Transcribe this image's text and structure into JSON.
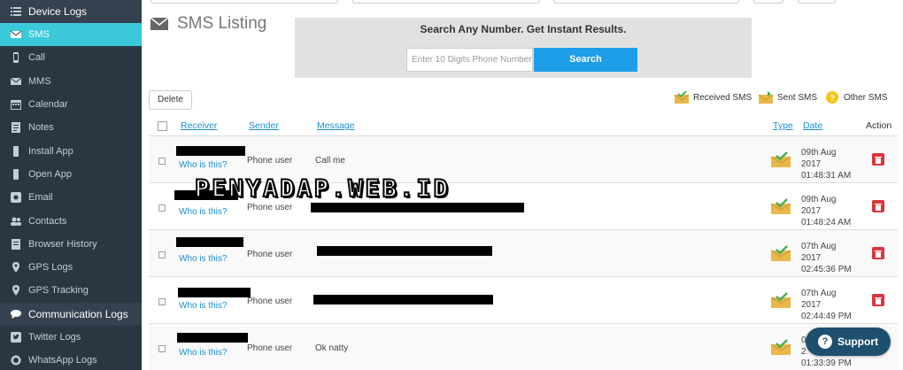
{
  "sidebar": {
    "items": [
      {
        "label": "Device Logs",
        "icon": "list-icon"
      },
      {
        "label": "SMS",
        "icon": "envelope-icon"
      },
      {
        "label": "Call",
        "icon": "phone-icon"
      },
      {
        "label": "MMS",
        "icon": "envelope-icon"
      },
      {
        "label": "Calendar",
        "icon": "calendar-icon"
      },
      {
        "label": "Notes",
        "icon": "notes-icon"
      },
      {
        "label": "Install App",
        "icon": "app-icon"
      },
      {
        "label": "Open App",
        "icon": "app-icon"
      },
      {
        "label": "Email",
        "icon": "email-icon"
      },
      {
        "label": "Contacts",
        "icon": "users-icon"
      },
      {
        "label": "Browser History",
        "icon": "history-icon"
      },
      {
        "label": "GPS Logs",
        "icon": "map-pin-icon"
      },
      {
        "label": "GPS Tracking",
        "icon": "map-pin-icon"
      },
      {
        "label": "Communication Logs",
        "icon": "chat-icon"
      },
      {
        "label": "Twitter Logs",
        "icon": "twitter-icon"
      },
      {
        "label": "WhatsApp Logs",
        "icon": "whatsapp-icon"
      }
    ]
  },
  "header": {
    "title": "SMS Listing"
  },
  "search": {
    "title": "Search Any Number. Get Instant Results.",
    "placeholder": "Enter 10 Digits Phone Number",
    "button_label": "Search"
  },
  "toolbar": {
    "delete_label": "Delete",
    "legend": [
      {
        "label": "Received SMS",
        "icon": "received-sms-icon"
      },
      {
        "label": "Sent SMS",
        "icon": "sent-sms-icon"
      },
      {
        "label": "Other SMS",
        "icon": "question-icon"
      }
    ]
  },
  "table": {
    "columns": {
      "receiver": "Receiver",
      "sender": "Sender",
      "message": "Message",
      "type": "Type",
      "date": "Date",
      "action": "Action"
    },
    "rows": [
      {
        "who": "Who is this?",
        "sender": "Phone user",
        "message": "Call me",
        "date1": "09th Aug",
        "date2": "2017",
        "date3": "01:48:31 AM"
      },
      {
        "who": "Who is this?",
        "sender": "Phone user",
        "message": "",
        "date1": "09th Aug",
        "date2": "2017",
        "date3": "01:48:24 AM"
      },
      {
        "who": "Who is this?",
        "sender": "Phone user",
        "message": "",
        "date1": "07th Aug",
        "date2": "2017",
        "date3": "02:45:36 PM"
      },
      {
        "who": "Who is this?",
        "sender": "Phone user",
        "message": "",
        "date1": "07th Aug",
        "date2": "2017",
        "date3": "02:44:49 PM"
      },
      {
        "who": "Who is this?",
        "sender": "Phone user",
        "message": "Ok natty",
        "date1": "0",
        "date2": "2",
        "date3": "01:33:39 PM"
      }
    ]
  },
  "watermark": "PENYADAP.WEB.ID",
  "support": {
    "label": "Support"
  },
  "colors": {
    "sidebar_bg": "#2b3643",
    "active": "#3bc9d9",
    "link": "#1a8fd0",
    "search_btn": "#1e9ee8",
    "danger": "#d9363e",
    "support": "#1e4f6e"
  }
}
